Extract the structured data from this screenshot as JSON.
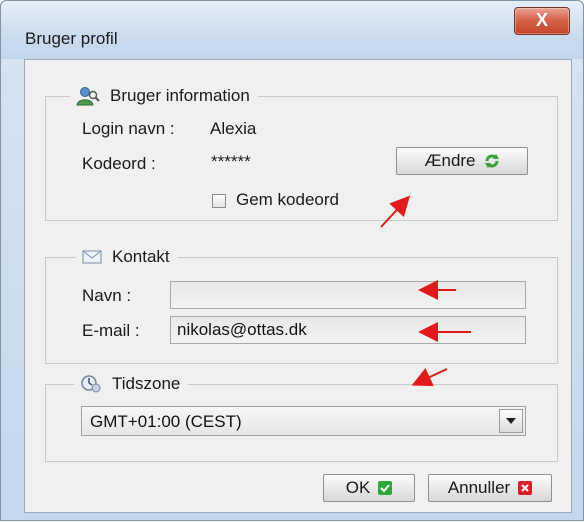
{
  "window": {
    "title": "Bruger profil",
    "close_label": "X"
  },
  "user_info": {
    "legend": "Bruger information",
    "login_label": "Login navn :",
    "login_value": "Alexia",
    "password_label": "Kodeord :",
    "password_value": "******",
    "change_button": "Ændre",
    "save_password_label": "Gem kodeord",
    "save_password_checked": false
  },
  "contact": {
    "legend": "Kontakt",
    "name_label": "Navn :",
    "name_value": "",
    "email_label": "E-mail :",
    "email_value": "nikolas@ottas.dk"
  },
  "timezone": {
    "legend": "Tidszone",
    "selected": "GMT+01:00 (CEST)"
  },
  "footer": {
    "ok_label": "OK",
    "cancel_label": "Annuller"
  },
  "icons": {
    "user": "user-icon",
    "mail": "mail-icon",
    "clock": "clock-icon",
    "refresh": "refresh-icon",
    "check": "check-icon",
    "close": "close-icon"
  },
  "colors": {
    "annotation_arrow": "#e11b1b",
    "ok_icon": "#2fa83a",
    "cancel_icon": "#d9202a",
    "refresh_icon": "#3aa13a",
    "close_button": "#c8452d"
  }
}
